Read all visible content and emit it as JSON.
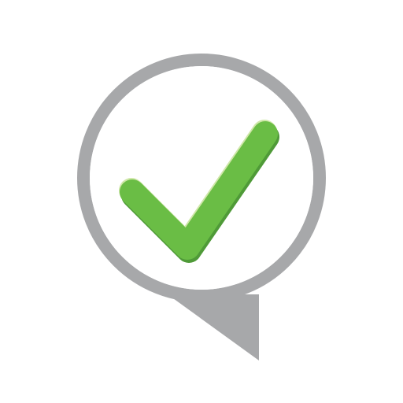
{
  "icon": {
    "name": "check-speech-bubble-icon",
    "colors": {
      "background": "#ffffff",
      "bubble_outline": "#a7a8aa",
      "bubble_fill": "#ffffff",
      "check_main": "#6abd45",
      "check_shadow": "#4f9a38",
      "check_highlight": "#cfe7a8"
    }
  }
}
